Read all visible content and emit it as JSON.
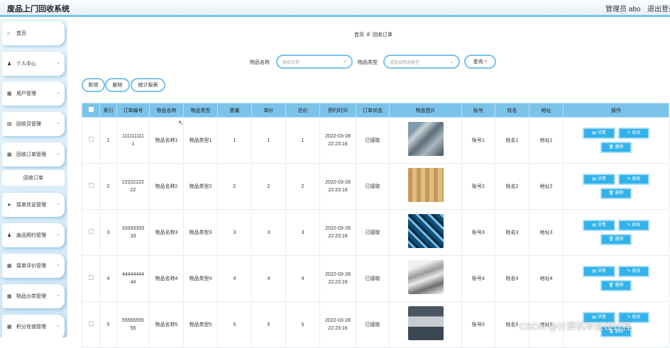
{
  "header": {
    "title": "废品上门回收系统",
    "admin": "管理员 abo",
    "logout": "退出登录"
  },
  "sidebar": {
    "items": [
      {
        "label": "首页",
        "icon": "home-icon",
        "glyph": "⌂",
        "chev": false
      },
      {
        "label": "个人中心",
        "icon": "user-icon",
        "glyph": "♟",
        "chev": true
      },
      {
        "label": "用户管理",
        "icon": "grid-icon",
        "glyph": "▦",
        "chev": true
      },
      {
        "label": "回收员管理",
        "icon": "grid-icon",
        "glyph": "▤",
        "chev": true
      },
      {
        "label": "回收订单管理",
        "icon": "grid-icon",
        "glyph": "▦",
        "chev": true
      },
      {
        "label": "接单信息管理",
        "icon": "send-icon",
        "glyph": "➤",
        "chev": true
      },
      {
        "label": "废品预约管理",
        "icon": "user-icon",
        "glyph": "♟",
        "chev": true
      },
      {
        "label": "接单评价管理",
        "icon": "grid-icon",
        "glyph": "▦",
        "chev": true
      },
      {
        "label": "物品分类管理",
        "icon": "grid-icon",
        "glyph": "▦",
        "chev": true
      },
      {
        "label": "积分充值管理",
        "icon": "grid-icon",
        "glyph": "▦",
        "chev": true
      }
    ],
    "sub": "回收订单"
  },
  "breadcrumb": {
    "home": "首页",
    "sep": "//",
    "current": "回收订单"
  },
  "search": {
    "name_label": "物品名称",
    "name_placeholder": "物品名称",
    "type_label": "物品类型",
    "type_placeholder": "请选择物品类型",
    "query": "查询"
  },
  "actions": {
    "add": "新增",
    "delete": "删除",
    "report": "统计报表"
  },
  "table": {
    "headers": [
      "索引",
      "订单编号",
      "物品名称",
      "物品类型",
      "重量",
      "单价",
      "总价",
      "预约时间",
      "订单状态",
      "物品图片",
      "账号",
      "姓名",
      "地址",
      "操作"
    ],
    "rows": [
      {
        "i": "1",
        "no": "1111111111",
        "name": "物品名称1",
        "type": "物品类型1",
        "w": "1",
        "price": "1",
        "total": "1",
        "time": "2022-03-28 22:23:16",
        "status": "已接取",
        "acc": "账号1",
        "person": "姓名1",
        "addr": "地址1"
      },
      {
        "i": "2",
        "no": "2222222222",
        "name": "物品名称2",
        "type": "物品类型2",
        "w": "2",
        "price": "2",
        "total": "2",
        "time": "2022-03-28 22:23:16",
        "status": "已接取",
        "acc": "账号2",
        "person": "姓名2",
        "addr": "地址2"
      },
      {
        "i": "3",
        "no": "3333333333",
        "name": "物品名称3",
        "type": "物品类型3",
        "w": "3",
        "price": "3",
        "total": "3",
        "time": "2022-03-28 22:23:16",
        "status": "已接取",
        "acc": "账号3",
        "person": "姓名3",
        "addr": "地址3"
      },
      {
        "i": "4",
        "no": "4444444444",
        "name": "物品名称4",
        "type": "物品类型4",
        "w": "4",
        "price": "4",
        "total": "4",
        "time": "2022-03-28 22:23:16",
        "status": "已接取",
        "acc": "账号4",
        "person": "姓名4",
        "addr": "地址4"
      },
      {
        "i": "5",
        "no": "5555555555",
        "name": "物品名称5",
        "type": "物品类型5",
        "w": "5",
        "price": "5",
        "total": "5",
        "time": "2022-03-28 22:23:16",
        "status": "已接取",
        "acc": "账号5",
        "person": "姓名5",
        "addr": "地址5"
      }
    ],
    "ops": {
      "detail": "详情",
      "edit": "修改",
      "del": "删除"
    }
  },
  "watermark": "CSDN @计算机毕业设计程"
}
